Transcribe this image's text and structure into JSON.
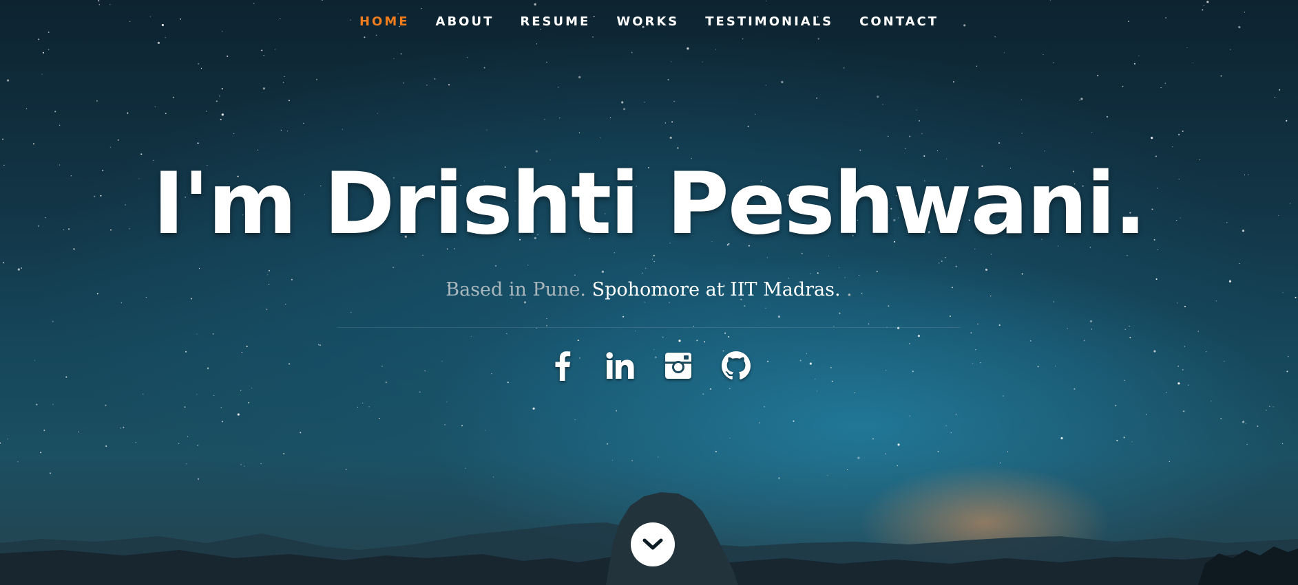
{
  "nav": {
    "items": [
      {
        "label": "HOME",
        "active": true
      },
      {
        "label": "ABOUT",
        "active": false
      },
      {
        "label": "RESUME",
        "active": false
      },
      {
        "label": "WORKS",
        "active": false
      },
      {
        "label": "TESTIMONIALS",
        "active": false
      },
      {
        "label": "CONTACT",
        "active": false
      }
    ],
    "active_color": "#f07c1e"
  },
  "hero": {
    "headline": "I'm Drishti Peshwani.",
    "subline_muted": "Based in Pune.",
    "subline_bright": "Spohomore at IIT Madras.",
    "subline_trailing": " ."
  },
  "social": {
    "icons": [
      "facebook-icon",
      "linkedin-icon",
      "instagram-icon",
      "github-icon"
    ]
  },
  "scroll_button": {
    "icon": "chevron-down-icon"
  }
}
